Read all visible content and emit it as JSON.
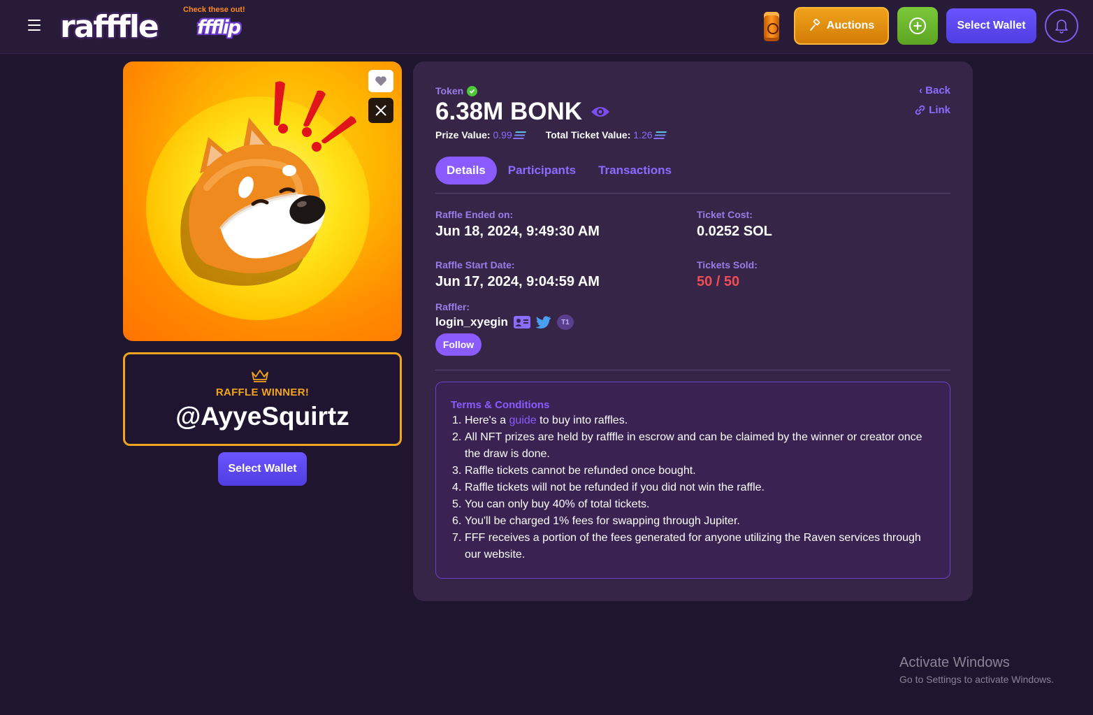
{
  "header": {
    "logo": "rafffle",
    "promo_label": "Check these out!",
    "promo_logo": "ffflip",
    "auctions_label": "Auctions",
    "select_wallet_label": "Select Wallet",
    "icons": [
      "menu-icon",
      "energy-can-icon",
      "gavel-icon",
      "plus-circle-icon",
      "bell-icon"
    ]
  },
  "nft": {
    "like_icon": "heart-icon",
    "share_icon": "x-logo-icon"
  },
  "winner": {
    "label": "RAFFLE WINNER!",
    "name": "@AyyeSquirtz"
  },
  "left_wallet_label": "Select Wallet",
  "detail": {
    "type_label": "Token",
    "title": "6.38M BONK",
    "prize_value_label": "Prize Value:",
    "prize_value": "0.99",
    "total_ticket_value_label": "Total Ticket Value:",
    "total_ticket_value": "1.26",
    "back_label": "Back",
    "link_label": "Link",
    "tabs": [
      {
        "label": "Details",
        "active": true
      },
      {
        "label": "Participants",
        "active": false
      },
      {
        "label": "Transactions",
        "active": false
      }
    ],
    "raffle_ended_label": "Raffle Ended on:",
    "raffle_ended": "Jun 18, 2024, 9:49:30 AM",
    "ticket_cost_label": "Ticket Cost:",
    "ticket_cost": "0.0252 SOL",
    "start_date_label": "Raffle Start Date:",
    "start_date": "Jun 17, 2024, 9:04:59 AM",
    "tickets_sold_label": "Tickets Sold:",
    "tickets_sold": "50 / 50",
    "raffler_label": "Raffler:",
    "raffler_name": "login_xyegin",
    "raffler_badge": "T1",
    "follow_label": "Follow"
  },
  "terms": {
    "title": "Terms & Conditions",
    "item1_before": "Here's a ",
    "item1_link": "guide",
    "item1_after": " to buy into raffles.",
    "items": [
      "All NFT prizes are held by rafffle in escrow and can be claimed by the winner or creator once the draw is done.",
      "Raffle tickets cannot be refunded once bought.",
      "Raffle tickets will not be refunded if you did not win the raffle.",
      "You can only buy 40% of total tickets.",
      "You'll be charged 1% fees for swapping through Jupiter.",
      "FFF receives a portion of the fees generated for anyone utilizing the Raven services through our website."
    ]
  },
  "watermark": {
    "line1": "Activate Windows",
    "line2": "Go to Settings to activate Windows."
  },
  "colors": {
    "background": "#20152f",
    "panel": "#372548",
    "accent": "#8a5cff",
    "auctions": "#e0900f",
    "create": "#6cb62e",
    "wallet": "#5b48f0",
    "winner_border": "#f2a51c",
    "tickets_sold": "#ef4d55"
  }
}
